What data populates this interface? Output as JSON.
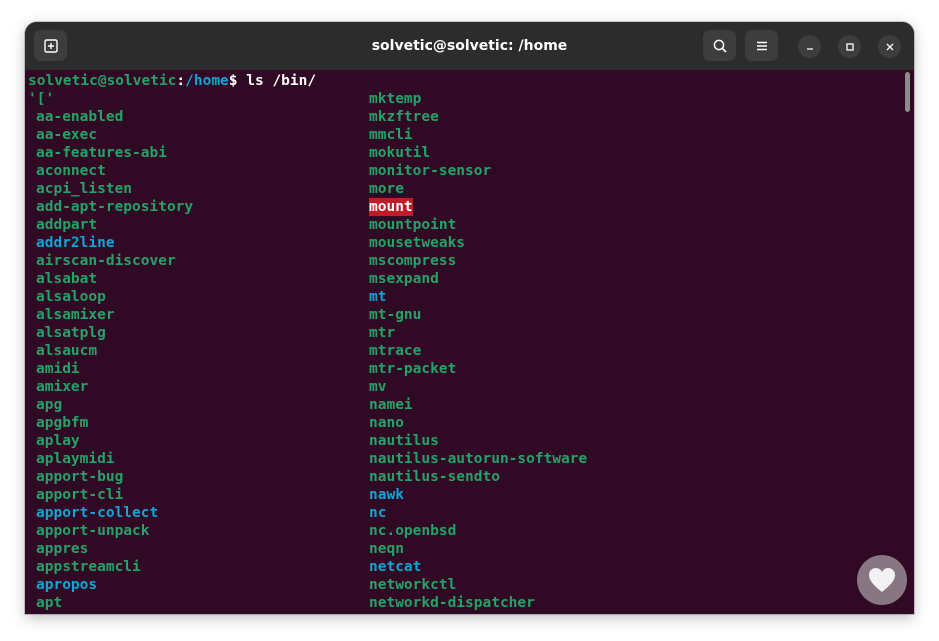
{
  "window": {
    "title": "solvetic@solvetic: /home",
    "icons": {
      "new_tab": "new-tab-icon",
      "search": "search-icon",
      "menu": "hamburger-menu-icon",
      "minimize": "minimize-icon",
      "maximize": "maximize-icon",
      "close": "close-icon"
    }
  },
  "terminal": {
    "prompt": {
      "user_host": "solvetic@solvetic",
      "sep": ":",
      "path": "/home",
      "dollar": "$",
      "command": " ls /bin/"
    },
    "colors": {
      "background": "#300a24",
      "executable": "#26a269",
      "symlink": "#12a4d6",
      "setuid_bg": "#c01c28"
    },
    "left_column": [
      {
        "name": "'['",
        "type": "exec"
      },
      {
        "name": "aa-enabled",
        "type": "exec"
      },
      {
        "name": "aa-exec",
        "type": "exec"
      },
      {
        "name": "aa-features-abi",
        "type": "exec"
      },
      {
        "name": "aconnect",
        "type": "exec"
      },
      {
        "name": "acpi_listen",
        "type": "exec"
      },
      {
        "name": "add-apt-repository",
        "type": "exec"
      },
      {
        "name": "addpart",
        "type": "exec"
      },
      {
        "name": "addr2line",
        "type": "link"
      },
      {
        "name": "airscan-discover",
        "type": "exec"
      },
      {
        "name": "alsabat",
        "type": "exec"
      },
      {
        "name": "alsaloop",
        "type": "exec"
      },
      {
        "name": "alsamixer",
        "type": "exec"
      },
      {
        "name": "alsatplg",
        "type": "exec"
      },
      {
        "name": "alsaucm",
        "type": "exec"
      },
      {
        "name": "amidi",
        "type": "exec"
      },
      {
        "name": "amixer",
        "type": "exec"
      },
      {
        "name": "apg",
        "type": "exec"
      },
      {
        "name": "apgbfm",
        "type": "exec"
      },
      {
        "name": "aplay",
        "type": "exec"
      },
      {
        "name": "aplaymidi",
        "type": "exec"
      },
      {
        "name": "apport-bug",
        "type": "exec"
      },
      {
        "name": "apport-cli",
        "type": "exec"
      },
      {
        "name": "apport-collect",
        "type": "link"
      },
      {
        "name": "apport-unpack",
        "type": "exec"
      },
      {
        "name": "appres",
        "type": "exec"
      },
      {
        "name": "appstreamcli",
        "type": "exec"
      },
      {
        "name": "apropos",
        "type": "link"
      },
      {
        "name": "apt",
        "type": "exec"
      }
    ],
    "right_column": [
      {
        "name": "mktemp",
        "type": "exec"
      },
      {
        "name": "mkzftree",
        "type": "exec"
      },
      {
        "name": "mmcli",
        "type": "exec"
      },
      {
        "name": "mokutil",
        "type": "exec"
      },
      {
        "name": "monitor-sensor",
        "type": "exec"
      },
      {
        "name": "more",
        "type": "exec"
      },
      {
        "name": "mount",
        "type": "setuid"
      },
      {
        "name": "mountpoint",
        "type": "exec"
      },
      {
        "name": "mousetweaks",
        "type": "exec"
      },
      {
        "name": "mscompress",
        "type": "exec"
      },
      {
        "name": "msexpand",
        "type": "exec"
      },
      {
        "name": "mt",
        "type": "link"
      },
      {
        "name": "mt-gnu",
        "type": "exec"
      },
      {
        "name": "mtr",
        "type": "exec"
      },
      {
        "name": "mtrace",
        "type": "exec"
      },
      {
        "name": "mtr-packet",
        "type": "exec"
      },
      {
        "name": "mv",
        "type": "exec"
      },
      {
        "name": "namei",
        "type": "exec"
      },
      {
        "name": "nano",
        "type": "exec"
      },
      {
        "name": "nautilus",
        "type": "exec"
      },
      {
        "name": "nautilus-autorun-software",
        "type": "exec"
      },
      {
        "name": "nautilus-sendto",
        "type": "exec"
      },
      {
        "name": "nawk",
        "type": "link"
      },
      {
        "name": "nc",
        "type": "link"
      },
      {
        "name": "nc.openbsd",
        "type": "exec"
      },
      {
        "name": "neqn",
        "type": "exec"
      },
      {
        "name": "netcat",
        "type": "link"
      },
      {
        "name": "networkctl",
        "type": "exec"
      },
      {
        "name": "networkd-dispatcher",
        "type": "exec"
      }
    ]
  }
}
